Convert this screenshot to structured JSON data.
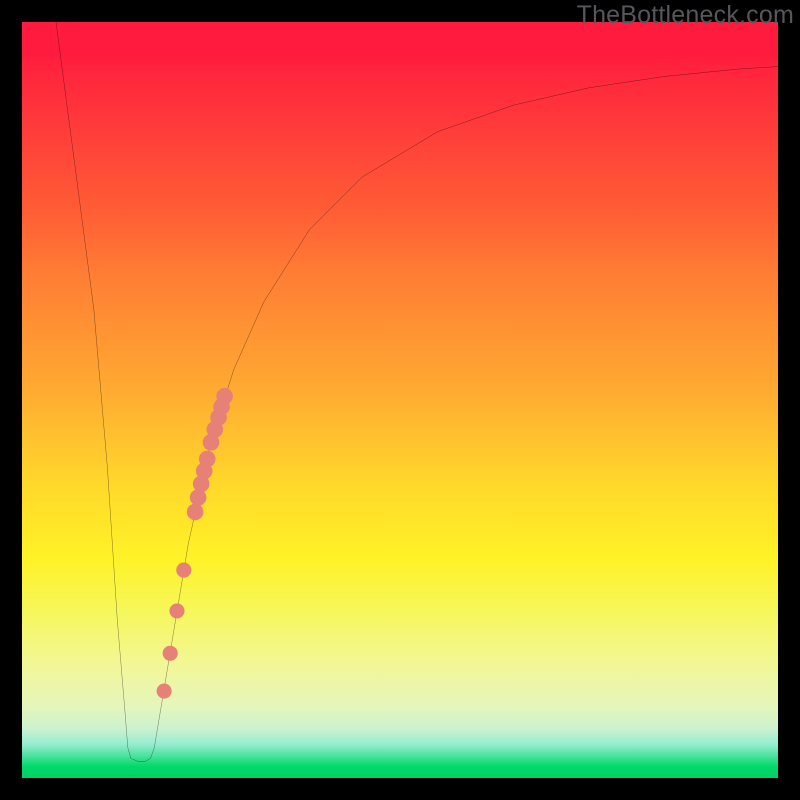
{
  "watermark": {
    "text": "TheBottleneck.com"
  },
  "chart_data": {
    "type": "line",
    "title": "",
    "xlabel": "",
    "ylabel": "",
    "xlim": [
      0,
      100
    ],
    "ylim": [
      0,
      100
    ],
    "grid": false,
    "curve": [
      {
        "x": 4.5,
        "y": 100
      },
      {
        "x": 9.5,
        "y": 62
      },
      {
        "x": 11.3,
        "y": 41
      },
      {
        "x": 12.6,
        "y": 21
      },
      {
        "x": 13.6,
        "y": 9
      },
      {
        "x": 14.0,
        "y": 4
      },
      {
        "x": 14.4,
        "y": 2.6
      },
      {
        "x": 15.3,
        "y": 2.2
      },
      {
        "x": 16.3,
        "y": 2.2
      },
      {
        "x": 17.0,
        "y": 2.6
      },
      {
        "x": 17.5,
        "y": 4
      },
      {
        "x": 19.0,
        "y": 13
      },
      {
        "x": 22.0,
        "y": 31
      },
      {
        "x": 25.0,
        "y": 44.5
      },
      {
        "x": 28.0,
        "y": 54
      },
      {
        "x": 32.0,
        "y": 63
      },
      {
        "x": 38.0,
        "y": 72.5
      },
      {
        "x": 45.0,
        "y": 79.5
      },
      {
        "x": 55.0,
        "y": 85.5
      },
      {
        "x": 65.0,
        "y": 89
      },
      {
        "x": 75.0,
        "y": 91.3
      },
      {
        "x": 85.0,
        "y": 92.8
      },
      {
        "x": 95.0,
        "y": 93.8
      },
      {
        "x": 100.0,
        "y": 94.1
      }
    ],
    "markers": [
      {
        "x": 18.8,
        "y": 11.5,
        "r": 1.0
      },
      {
        "x": 19.6,
        "y": 16.5,
        "r": 1.0
      },
      {
        "x": 20.5,
        "y": 22.1,
        "r": 1.0
      },
      {
        "x": 21.4,
        "y": 27.5,
        "r": 1.0
      },
      {
        "x": 22.9,
        "y": 35.2,
        "r": 1.1
      },
      {
        "x": 23.3,
        "y": 37.1,
        "r": 1.1
      },
      {
        "x": 23.7,
        "y": 38.9,
        "r": 1.1
      },
      {
        "x": 24.1,
        "y": 40.6,
        "r": 1.1
      },
      {
        "x": 24.5,
        "y": 42.2,
        "r": 1.1
      },
      {
        "x": 25.0,
        "y": 44.4,
        "r": 1.1
      },
      {
        "x": 25.5,
        "y": 46.1,
        "r": 1.1
      },
      {
        "x": 26.0,
        "y": 47.7,
        "r": 1.1
      },
      {
        "x": 26.4,
        "y": 49.1,
        "r": 1.1
      },
      {
        "x": 26.8,
        "y": 50.5,
        "r": 1.1
      }
    ],
    "marker_color": "#e78177",
    "curve_color": "#000000"
  }
}
